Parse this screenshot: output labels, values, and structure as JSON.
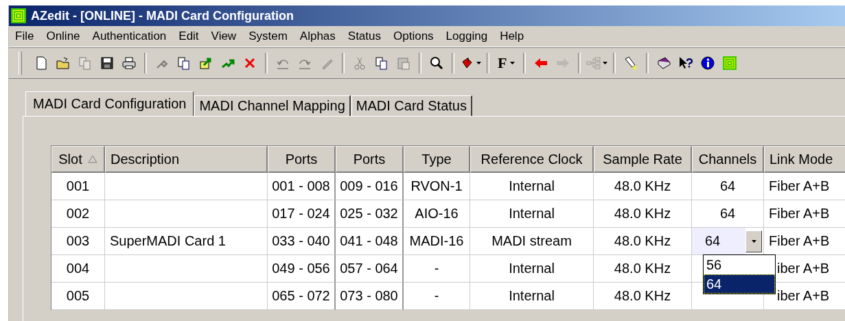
{
  "window": {
    "title": "AZedit - [ONLINE] - MADI Card Configuration"
  },
  "menu": [
    "File",
    "Online",
    "Authentication",
    "Edit",
    "View",
    "System",
    "Alphas",
    "Status",
    "Options",
    "Logging",
    "Help"
  ],
  "toolbar": [
    {
      "kind": "button",
      "disabled": false
    },
    {
      "kind": "button",
      "disabled": false
    },
    {
      "kind": "button",
      "disabled": true
    },
    {
      "kind": "button",
      "disabled": false
    },
    {
      "kind": "button",
      "disabled": false
    },
    {
      "kind": "separator"
    },
    {
      "kind": "button",
      "disabled": true
    },
    {
      "kind": "button",
      "disabled": false
    },
    {
      "kind": "button",
      "disabled": false
    },
    {
      "kind": "button",
      "disabled": false
    },
    {
      "kind": "button",
      "disabled": false
    },
    {
      "kind": "separator"
    },
    {
      "kind": "button",
      "disabled": true
    },
    {
      "kind": "button",
      "disabled": true
    },
    {
      "kind": "button",
      "disabled": true
    },
    {
      "kind": "separator"
    },
    {
      "kind": "button",
      "disabled": true
    },
    {
      "kind": "button",
      "disabled": false
    },
    {
      "kind": "button",
      "disabled": true
    },
    {
      "kind": "separator"
    },
    {
      "kind": "button",
      "disabled": false
    },
    {
      "kind": "separator"
    },
    {
      "kind": "dropdown",
      "disabled": false
    },
    {
      "kind": "separator"
    },
    {
      "kind": "font",
      "label": "F"
    },
    {
      "kind": "separator"
    },
    {
      "kind": "button",
      "disabled": false
    },
    {
      "kind": "button",
      "disabled": true
    },
    {
      "kind": "separator"
    },
    {
      "kind": "dropdown",
      "disabled": true
    },
    {
      "kind": "separator"
    },
    {
      "kind": "button",
      "disabled": false
    },
    {
      "kind": "separator"
    },
    {
      "kind": "button",
      "disabled": false
    },
    {
      "kind": "button",
      "disabled": false
    },
    {
      "kind": "button",
      "disabled": false
    },
    {
      "kind": "button",
      "disabled": false
    }
  ],
  "tabs": [
    {
      "label": "MADI Card Configuration",
      "selected": true
    },
    {
      "label": "MADI Channel Mapping",
      "selected": false
    },
    {
      "label": "MADI Card Status",
      "selected": false
    }
  ],
  "table": {
    "columns": [
      {
        "label": "Slot",
        "sorted": true
      },
      {
        "label": "Description",
        "sorted": false
      },
      {
        "label": "Ports",
        "sorted": false
      },
      {
        "label": "Ports",
        "sorted": false
      },
      {
        "label": "Type",
        "sorted": false
      },
      {
        "label": "Reference Clock",
        "sorted": false
      },
      {
        "label": "Sample Rate",
        "sorted": false
      },
      {
        "label": "Channels",
        "sorted": false
      },
      {
        "label": "Link Mode",
        "sorted": false
      }
    ],
    "rows": [
      {
        "slot": "001",
        "ports_1": "001 - 008",
        "ports_2": "009 - 016",
        "type": "RVON-1",
        "reference_clock": "Internal",
        "sample_rate": "48.0 KHz",
        "channels": "64",
        "link_mode": "Fiber A+B",
        "editing": false
      },
      {
        "slot": "002",
        "ports_1": "017 - 024",
        "ports_2": "025 - 032",
        "type": "AIO-16",
        "reference_clock": "Internal",
        "sample_rate": "48.0 KHz",
        "channels": "64",
        "link_mode": "Fiber A+B",
        "editing": false
      },
      {
        "slot": "003",
        "description": "SuperMADI Card 1",
        "ports_1": "033 - 040",
        "ports_2": "041 - 048",
        "type": "MADI-16",
        "reference_clock": "MADI stream",
        "sample_rate": "48.0 KHz",
        "channels": "64",
        "link_mode": "Fiber A+B",
        "editing": true
      },
      {
        "slot": "004",
        "ports_1": "049 - 056",
        "ports_2": "057 - 064",
        "type": "-",
        "reference_clock": "Internal",
        "sample_rate": "48.0 KHz",
        "link_mode": "iber A+B",
        "editing": false
      },
      {
        "slot": "005",
        "ports_1": "065 - 072",
        "ports_2": "073 - 080",
        "type": "-",
        "reference_clock": "Internal",
        "sample_rate": "48.0 KHz",
        "link_mode": "iber A+B",
        "editing": false
      }
    ],
    "dropdown": {
      "options": [
        {
          "label": "56",
          "selected": false
        },
        {
          "label": "64",
          "selected": true
        }
      ]
    }
  }
}
